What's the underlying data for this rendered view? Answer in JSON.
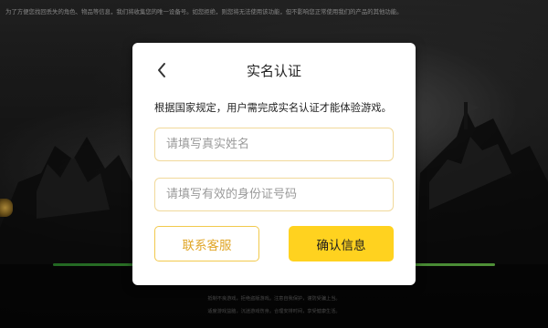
{
  "background": {
    "notice": "为了方便您找回丢失的角色、物品等信息，我们将收集您的唯一设备号。如您拒绝，则您将无法使用该功能，但不影响您正常使用我们的产品的其他功能。",
    "progress_fraction": 1.0,
    "footer_line1": "抵制不良游戏，拒绝盗版游戏。注意自我保护，谨防受骗上当。",
    "footer_line2": "适度游戏益脑，沉迷游戏伤身。合理安排时间，享受健康生活。"
  },
  "dialog": {
    "title": "实名认证",
    "description": "根据国家规定，用户需完成实名认证才能体验游戏。",
    "name_placeholder": "请填写真实姓名",
    "name_value": "",
    "id_placeholder": "请填写有效的身份证号码",
    "id_value": "",
    "service_button": "联系客服",
    "confirm_button": "确认信息",
    "back_icon": "chevron-left-icon"
  },
  "colors": {
    "accent_yellow": "#ffd21f",
    "service_text": "#e0a526",
    "input_border": "#f1d99a",
    "progress_green": "#4caf3a"
  }
}
